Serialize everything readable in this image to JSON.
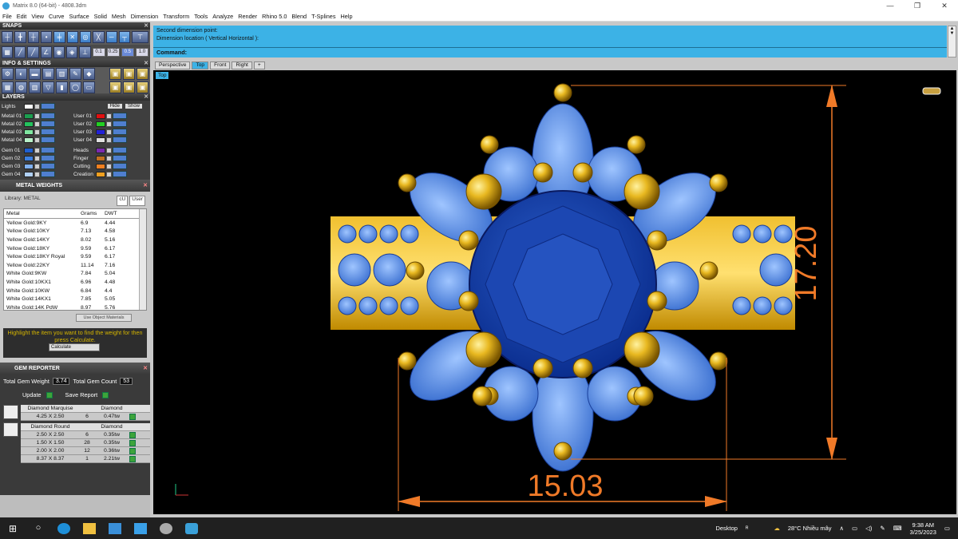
{
  "window": {
    "title": "Matrix 8.0 (64-bit) - 4808.3dm",
    "controls": [
      "—",
      "❐",
      "✕"
    ]
  },
  "menu": [
    "File",
    "Edit",
    "View",
    "Curve",
    "Surface",
    "Solid",
    "Mesh",
    "Dimension",
    "Transform",
    "Tools",
    "Analyze",
    "Render",
    "Rhino 5.0",
    "Blend",
    "T-Splines",
    "Help"
  ],
  "panels": {
    "snaps": {
      "title": "SNAPS",
      "values": [
        "0.1",
        "0.25",
        "0.5",
        "1.0"
      ]
    },
    "info": {
      "title": "INFO & SETTINGS"
    },
    "layers": {
      "title": "LAYERS",
      "lights": "Lights",
      "hide": "Hide",
      "show": "Show",
      "left": [
        {
          "name": "Metal 01",
          "color": "#1b9e4f"
        },
        {
          "name": "Metal 02",
          "color": "#23c25d"
        },
        {
          "name": "Metal 03",
          "color": "#7fe6a0"
        },
        {
          "name": "Metal 04",
          "color": "#b8f0c8"
        },
        {
          "name": "Gem 01",
          "color": "#1f5fcf"
        },
        {
          "name": "Gem 02",
          "color": "#3b7fe0"
        },
        {
          "name": "Gem 03",
          "color": "#7fb0f0"
        },
        {
          "name": "Gem 04",
          "color": "#b0d0f5"
        }
      ],
      "right": [
        {
          "name": "User 01",
          "color": "#e01010"
        },
        {
          "name": "User 02",
          "color": "#22d022"
        },
        {
          "name": "User 03",
          "color": "#2222d8"
        },
        {
          "name": "User 04",
          "color": "#e0e0e0"
        },
        {
          "name": "Heads",
          "color": "#7a2ab0"
        },
        {
          "name": "Finger",
          "color": "#c07020"
        },
        {
          "name": "Cutting",
          "color": "#f08020"
        },
        {
          "name": "Creation",
          "color": "#f0a020"
        }
      ]
    },
    "metal_weights": {
      "title": "METAL WEIGHTS",
      "library": "Library: METAL",
      "cu": "cU",
      "user": "User",
      "headers": [
        "Metal",
        "Grams",
        "DWT"
      ],
      "rows": [
        [
          "Yellow Gold:9KY",
          "6.9",
          "4.44"
        ],
        [
          "Yellow Gold:10KY",
          "7.13",
          "4.58"
        ],
        [
          "Yellow Gold:14KY",
          "8.02",
          "5.16"
        ],
        [
          "Yellow Gold:18KY",
          "9.59",
          "6.17"
        ],
        [
          "Yellow Gold:18KY Royal",
          "9.59",
          "6.17"
        ],
        [
          "Yellow Gold:22KY",
          "11.14",
          "7.16"
        ],
        [
          "White Gold:9KW",
          "7.84",
          "5.04"
        ],
        [
          "White Gold:10KX1",
          "6.96",
          "4.48"
        ],
        [
          "White Gold:10KW",
          "6.84",
          "4.4"
        ],
        [
          "White Gold:14KX1",
          "7.85",
          "5.05"
        ],
        [
          "White Gold:14K PdW",
          "8.97",
          "5.76"
        ]
      ],
      "use_object": "Use Object Materials",
      "hint": "Highlight the item you want to find the weight for then press Calculate.",
      "calculate": "Calculate"
    },
    "gem_reporter": {
      "title": "GEM REPORTER",
      "total_weight_label": "Total Gem Weight",
      "total_weight": "3.74",
      "total_count_label": "Total Gem Count",
      "total_count": "53",
      "update": "Update",
      "save": "Save Report",
      "groups": [
        {
          "shape": "Diamond Marquise",
          "material": "Diamond",
          "rows": [
            [
              "4.25 X 2.50",
              "6",
              "0.47tw"
            ]
          ]
        },
        {
          "shape": "Diamond Round",
          "material": "Diamond",
          "rows": [
            [
              "2.50 X 2.50",
              "6",
              "0.35tw"
            ],
            [
              "1.50 X 1.50",
              "28",
              "0.35tw"
            ],
            [
              "2.00 X 2.00",
              "12",
              "0.36tw"
            ],
            [
              "8.37 X 8.37",
              "1",
              "2.21tw"
            ]
          ]
        }
      ]
    }
  },
  "command": {
    "history": [
      "Second dimension point:",
      "Dimension location ( Vertical  Horizontal ):"
    ],
    "label": "Command:"
  },
  "tabs": [
    "Perspective",
    "Top",
    "Front",
    "Right",
    "+"
  ],
  "viewport": {
    "label": "Top",
    "dim_horizontal": "15.03",
    "dim_vertical": "17.20",
    "dim_color": "#f07a28"
  },
  "taskbar": {
    "desktop": "Desktop",
    "weather": "28°C  Nhiều mây",
    "time": "9:38 AM",
    "date": "3/25/2023"
  }
}
